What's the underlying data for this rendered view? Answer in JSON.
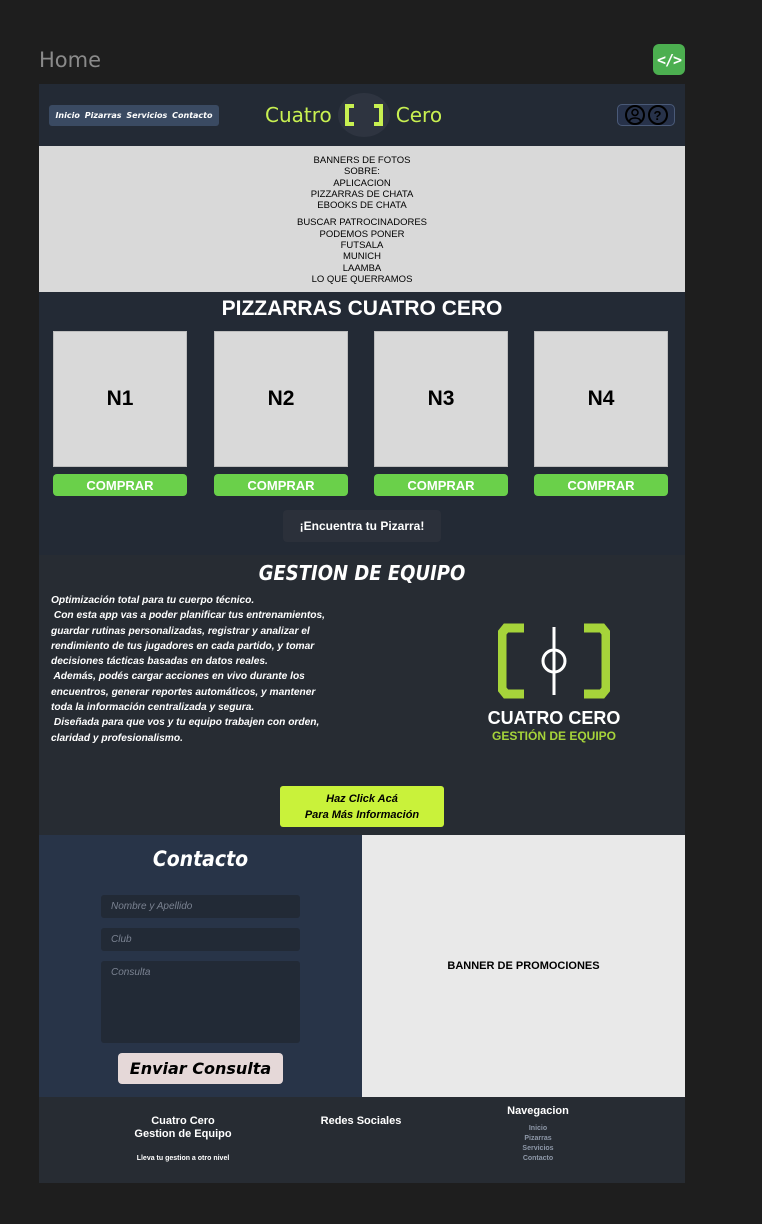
{
  "canvas": {
    "frame_label": "Home",
    "code_icon": "code-brackets-icon",
    "code_color": "#4caf50"
  },
  "header": {
    "nav_items": [
      "Inicio",
      "Pizarras",
      "Servicios",
      "Contacto"
    ],
    "brand_left": "Cuatro",
    "brand_right": "Cero",
    "brand_color": "#c8f051",
    "icons": [
      "user-icon",
      "help-icon"
    ],
    "help_glyph": "?"
  },
  "banner": {
    "lines_a": [
      "BANNERS DE FOTOS",
      "SOBRE:",
      "APLICACION",
      "PIZZARRAS DE CHATA",
      "EBOOKS DE CHATA"
    ],
    "lines_b": [
      "BUSCAR PATROCINADORES",
      "PODEMOS PONER",
      "FUTSALA",
      "MUNICH",
      "LAAMBA",
      "LO QUE QUERRAMOS"
    ]
  },
  "pizarras": {
    "title": "PIZZARRAS CUATRO CERO",
    "cards": [
      {
        "label": "N1",
        "button": "COMPRAR"
      },
      {
        "label": "N2",
        "button": "COMPRAR"
      },
      {
        "label": "N3",
        "button": "COMPRAR"
      },
      {
        "label": "N4",
        "button": "COMPRAR"
      }
    ],
    "find_button": "¡Encuentra tu Pizarra!",
    "button_color": "#6ad04a"
  },
  "gestion": {
    "title": "GESTION DE EQUIPO",
    "paragraph_lines": [
      "Optimización total para tu cuerpo técnico.",
      " Con esta app vas a poder planificar tus entrenamientos,",
      "guardar rutinas personalizadas, registrar y analizar el",
      "rendimiento de tus jugadores en cada partido, y tomar",
      "decisiones tácticas basadas en datos reales.",
      " Además, podés cargar acciones en vivo durante los",
      "encuentros, generar reportes automáticos, y mantener",
      "toda la información centralizada y segura.",
      " Diseñada para que vos y tu equipo trabajen con orden,",
      "claridad y profesionalismo."
    ],
    "logo_name": "CUATRO CERO",
    "logo_sub": "GESTIÓN DE EQUIPO",
    "logo_color": "#a6d43a",
    "cta_line1": "Haz Click Acá",
    "cta_line2": "Para Más Información",
    "cta_color": "#c9f23a"
  },
  "contacto": {
    "title": "Contacto",
    "name_placeholder": "Nombre y Apellido",
    "club_placeholder": "Club",
    "query_placeholder": "Consulta",
    "send_button": "Enviar Consulta"
  },
  "promo": {
    "label": "BANNER DE PROMOCIONES"
  },
  "footer": {
    "brand_line1": "Cuatro Cero",
    "brand_line2": "Gestion de Equipo",
    "tagline": "Lleva tu gestion a otro nivel",
    "social_title": "Redes Sociales",
    "nav_title": "Navegacion",
    "nav_links": [
      "Inicio",
      "Pizarras",
      "Servicios",
      "Contacto"
    ]
  }
}
